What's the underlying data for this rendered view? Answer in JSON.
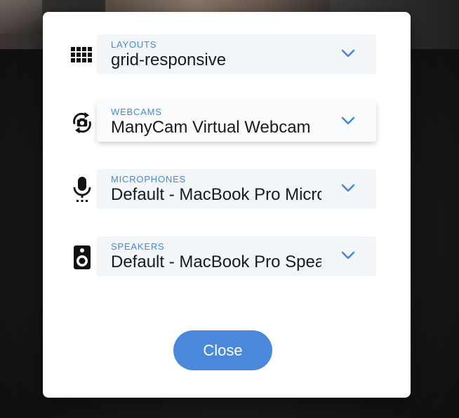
{
  "modal": {
    "rows": [
      {
        "label": "LAYOUTS",
        "value": "grid-responsive",
        "icon": "grid-layout-icon"
      },
      {
        "label": "WEBCAMS",
        "value": "ManyCam Virtual Webcam",
        "icon": "camera-switch-icon"
      },
      {
        "label": "MICROPHONES",
        "value": "Default - MacBook Pro Microphone",
        "icon": "microphone-icon"
      },
      {
        "label": "SPEAKERS",
        "value": "Default - MacBook Pro Speakers",
        "icon": "speaker-icon"
      }
    ],
    "close_label": "Close"
  },
  "colors": {
    "accent": "#4a88dc",
    "label": "#3f8ad8",
    "field_bg": "#f3f6f9"
  }
}
